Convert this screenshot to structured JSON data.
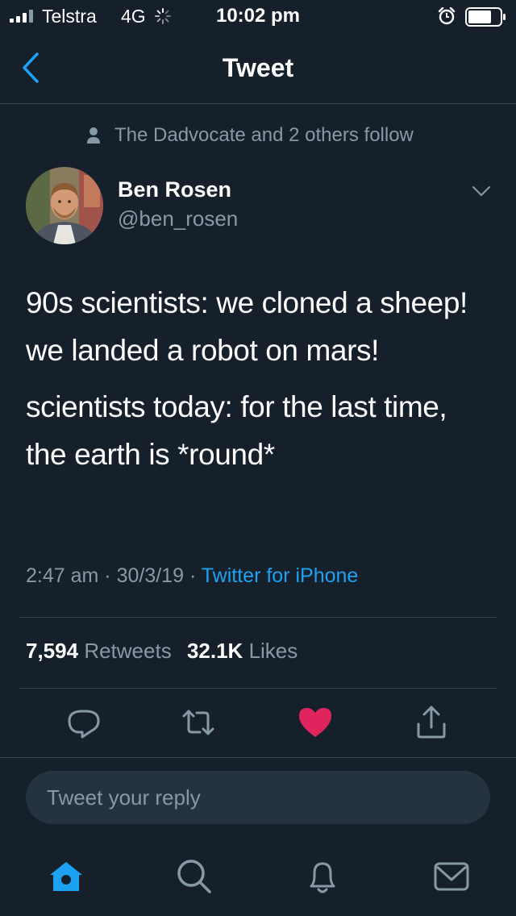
{
  "status_bar": {
    "carrier": "Telstra",
    "network": "4G",
    "time": "10:02 pm",
    "signal_bars_filled": 3,
    "signal_bars_total": 4,
    "icons": [
      "signal-icon",
      "activity-spinner-icon",
      "alarm-icon",
      "battery-icon"
    ]
  },
  "nav": {
    "title": "Tweet",
    "back_icon": "chevron-left-icon"
  },
  "context": {
    "text": "The Dadvocate and 2 others follow",
    "icon": "person-icon"
  },
  "author": {
    "name": "Ben Rosen",
    "handle": "@ben_rosen"
  },
  "tweet": {
    "paragraph_1": "90s scientists: we cloned a sheep! we landed a robot on mars!",
    "paragraph_2": "scientists today: for the last time, the earth is *round*",
    "time": "2:47 am",
    "date": "30/3/19",
    "separator": "·",
    "source": "Twitter for iPhone"
  },
  "stats": {
    "retweets_count": "7,594",
    "retweets_label": "Retweets",
    "likes_count": "32.1K",
    "likes_label": "Likes"
  },
  "actions": [
    "reply-icon",
    "retweet-icon",
    "like-icon",
    "share-icon"
  ],
  "reply_bar": {
    "placeholder": "Tweet your reply"
  },
  "tab_bar": [
    "home-icon",
    "search-icon",
    "notifications-icon",
    "messages-icon"
  ],
  "colors": {
    "background": "#15202b",
    "accent": "#1da1f2",
    "like": "#e0245e",
    "secondary_text": "#8899a6",
    "divider": "#38444d"
  }
}
